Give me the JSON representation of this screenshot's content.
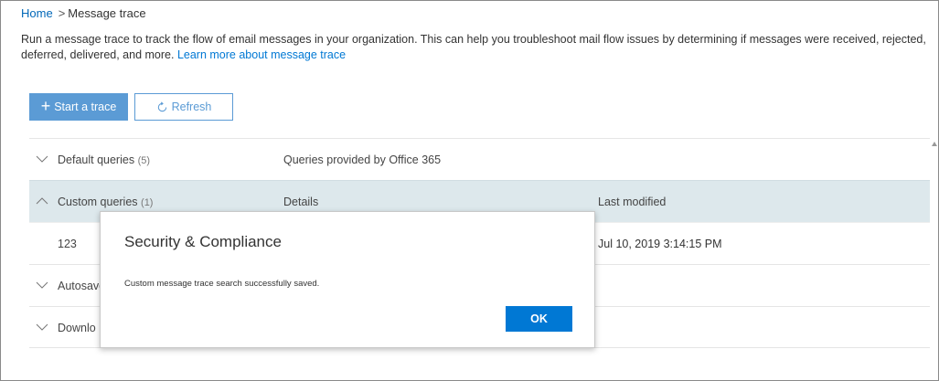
{
  "breadcrumb": {
    "home": "Home",
    "separator": ">",
    "current": "Message trace"
  },
  "description": {
    "text": "Run a message trace to track the flow of email messages in your organization. This can help you troubleshoot mail flow issues by determining if messages were received, rejected, deferred, delivered, and more. ",
    "link": "Learn more about message trace"
  },
  "toolbar": {
    "start_label": "Start a trace",
    "start_icon": "plus-icon",
    "refresh_label": "Refresh",
    "refresh_icon": "refresh-icon"
  },
  "queries": {
    "default": {
      "name": "Default queries",
      "count": "(5)",
      "details": "Queries provided by Office 365"
    },
    "custom": {
      "name": "Custom queries",
      "count": "(1)",
      "details_header": "Details",
      "last_modified_header": "Last modified",
      "items": [
        {
          "name": "123",
          "last_modified": "Jul 10, 2019 3:14:15 PM"
        }
      ]
    },
    "autosaved": {
      "name": "Autosave"
    },
    "downloadable": {
      "name": "Downlo"
    }
  },
  "dialog": {
    "title": "Security & Compliance",
    "message": "Custom message trace search successfully saved.",
    "ok_label": "OK"
  },
  "colors": {
    "accent": "#0078d4",
    "start_button": "#5b9bd5",
    "highlight_row": "#dde8ec"
  }
}
